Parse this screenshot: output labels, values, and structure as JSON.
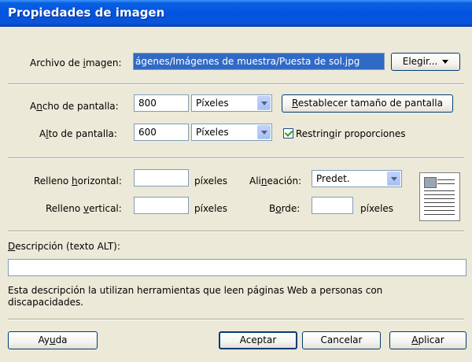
{
  "window": {
    "title": "Propiedades de imagen"
  },
  "file": {
    "label_pre": "Archivo de ",
    "label_u": "i",
    "label_post": "magen:",
    "value": "ágenes/Imágenes de muestra/Puesta de sol.jpg",
    "choose_label": "Elegir..."
  },
  "size": {
    "width_label_pre": "A",
    "width_label_u": "n",
    "width_label_post": "cho de pantalla:",
    "width_value": "800",
    "width_unit": "Píxeles",
    "height_label_pre": "A",
    "height_label_u": "l",
    "height_label_post": "to de pantalla:",
    "height_value": "600",
    "height_unit": "Píxeles",
    "reset_label_u": "R",
    "reset_label_post": "establecer tamaño de pantalla",
    "constrain_label_pre": "Restrin",
    "constrain_label_u": "g",
    "constrain_label_post": "ir proporciones",
    "constrain_checked": true
  },
  "layout": {
    "hpad_label_pre": "Relleno ",
    "hpad_label_u": "h",
    "hpad_label_post": "orizontal:",
    "hpad_value": "",
    "hpad_unit": "píxeles",
    "vpad_label_pre": "Relleno ",
    "vpad_label_u": "v",
    "vpad_label_post": "ertical:",
    "vpad_value": "",
    "vpad_unit": "píxeles",
    "align_label_pre": "Ali",
    "align_label_u": "n",
    "align_label_post": "eación:",
    "align_value": "Predet.",
    "border_label_pre": "B",
    "border_label_u": "o",
    "border_label_post": "rde:",
    "border_value": "",
    "border_unit": "píxeles"
  },
  "alt": {
    "label_u": "D",
    "label_post": "escripción (texto ALT):",
    "value": "",
    "help": "Esta descripción la utilizan herramientas que leen páginas Web a personas con discapacidades."
  },
  "buttons": {
    "help_pre": "Ay",
    "help_u": "u",
    "help_post": "da",
    "ok": "Aceptar",
    "cancel": "Cancelar",
    "apply_u": "A",
    "apply_post": "plicar"
  }
}
